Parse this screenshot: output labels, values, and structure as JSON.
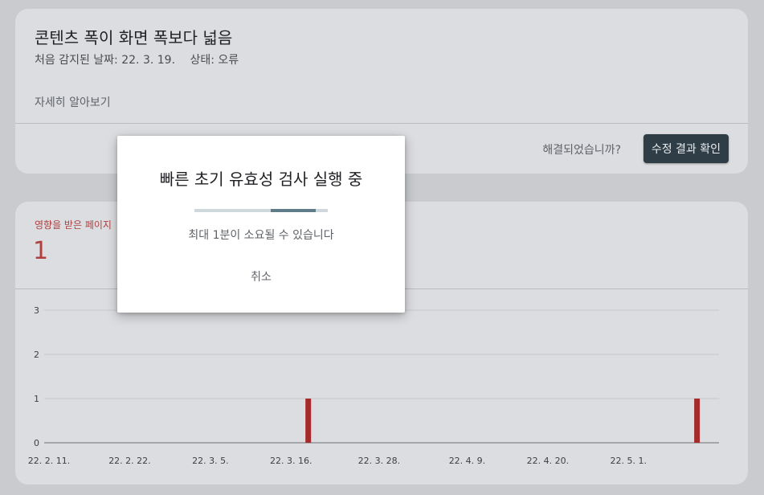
{
  "issue": {
    "title": "콘텐츠 폭이 화면 폭보다 넓음",
    "first_detected": "처음 감지된 날짜: 22. 3. 19.",
    "status": "상태: 오류",
    "learn_more": "자세히 알아보기",
    "resolved_question": "해결되었습니까?",
    "validate_button": "수정 결과 확인"
  },
  "affected": {
    "label": "영향을 받은 페이지",
    "count": "1"
  },
  "chart_data": {
    "type": "bar",
    "categories": [
      "22. 2. 11.",
      "22. 2. 22.",
      "22. 3. 5.",
      "22. 3. 16.",
      "22. 3. 28.",
      "22. 4. 9.",
      "22. 4. 20.",
      "22. 5. 1."
    ],
    "x_ticks": [
      "22. 2. 11.",
      "22. 2. 22.",
      "22. 3. 5.",
      "22. 3. 16.",
      "22. 3. 28.",
      "22. 4. 9.",
      "22. 4. 20.",
      "22. 5. 1."
    ],
    "y_ticks": [
      "0",
      "1",
      "2",
      "3"
    ],
    "ylim": [
      0,
      3
    ],
    "bars": [
      {
        "date": "22. 3. 19.",
        "value": 1
      },
      {
        "date": "22. 5. 11.",
        "value": 1
      }
    ],
    "grid": true,
    "bar_color": "#a52a2a"
  },
  "dialog": {
    "title": "빠른 초기 유효성 검사 실행 중",
    "subtitle": "최대 1분이 소요될 수 있습니다",
    "cancel": "취소",
    "progress": 0.5
  }
}
